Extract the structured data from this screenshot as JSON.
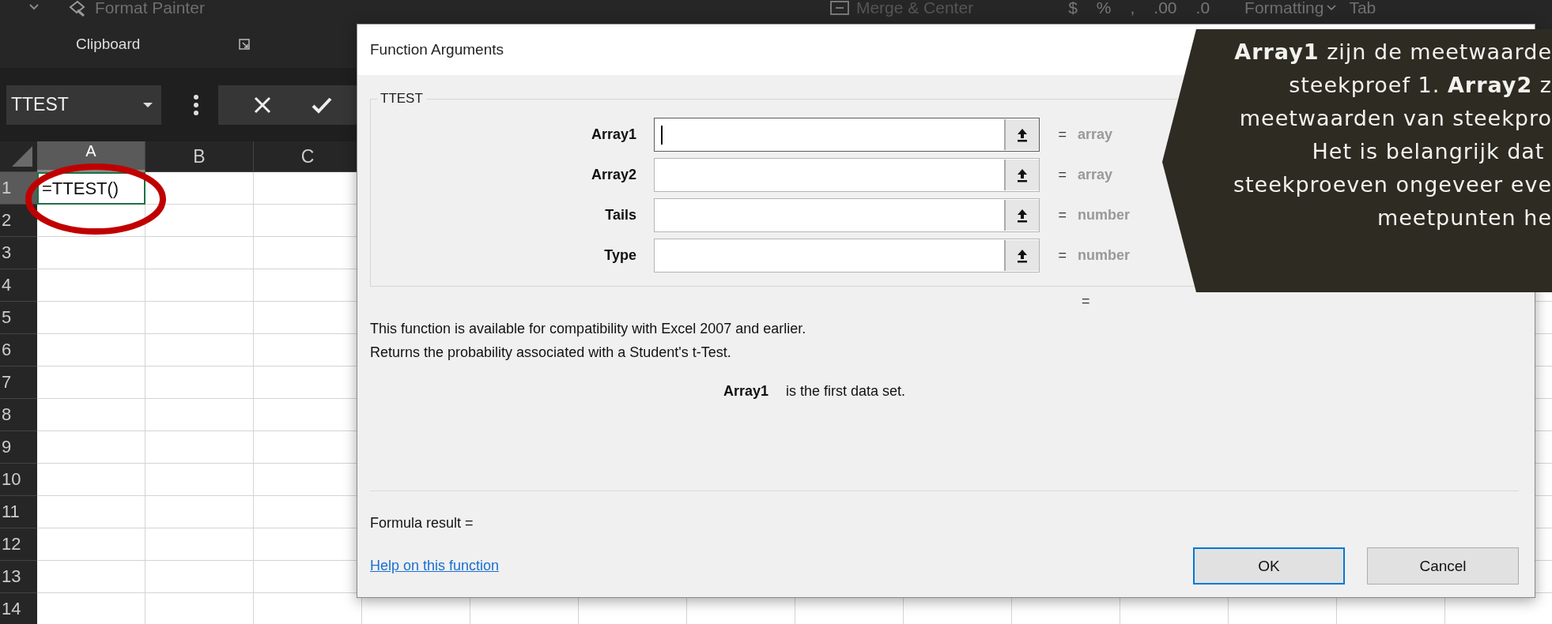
{
  "ribbon": {
    "top_texts": [
      {
        "kind": "painter",
        "text": "Format Painter"
      },
      {
        "kind": "merge",
        "text": "Merge & Center"
      },
      {
        "kind": "glyph",
        "text": "$"
      },
      {
        "kind": "glyph",
        "text": "%"
      },
      {
        "kind": "glyph",
        "text": ","
      },
      {
        "kind": "glyph",
        "text": ".00"
      },
      {
        "kind": "glyph",
        "text": ".0"
      },
      {
        "kind": "dropdown",
        "text": "Formatting"
      },
      {
        "kind": "plain",
        "text": "Tab"
      }
    ],
    "group_label": "Clipboard"
  },
  "formula_bar": {
    "name_box": "TTEST"
  },
  "sheet": {
    "columns": [
      {
        "label": "A",
        "selected": true
      },
      {
        "label": "B",
        "selected": false
      },
      {
        "label": "C",
        "selected": false
      }
    ],
    "rows": [
      {
        "label": "1",
        "selected": true
      },
      {
        "label": "2",
        "selected": false
      },
      {
        "label": "3",
        "selected": false
      },
      {
        "label": "4",
        "selected": false
      },
      {
        "label": "5",
        "selected": false
      },
      {
        "label": "6",
        "selected": false
      },
      {
        "label": "7",
        "selected": false
      },
      {
        "label": "8",
        "selected": false
      },
      {
        "label": "9",
        "selected": false
      },
      {
        "label": "10",
        "selected": false
      },
      {
        "label": "11",
        "selected": false
      },
      {
        "label": "12",
        "selected": false
      },
      {
        "label": "13",
        "selected": false
      },
      {
        "label": "14",
        "selected": false
      }
    ],
    "active_cell": "=TTEST()"
  },
  "dialog": {
    "title": "Function Arguments",
    "group_label": "TTEST",
    "arguments": [
      {
        "label": "Array1",
        "equals": "=",
        "hint": "array",
        "focused": true
      },
      {
        "label": "Array2",
        "equals": "=",
        "hint": "array",
        "focused": false
      },
      {
        "label": "Tails",
        "equals": "=",
        "hint": "number",
        "focused": false
      },
      {
        "label": "Type",
        "equals": "=",
        "hint": "number",
        "focused": false
      }
    ],
    "result_equals": "=",
    "description": [
      "This function is available for compatibility with Excel 2007 and earlier.",
      "Returns the probability associated with a Student's t-Test."
    ],
    "argument_help": {
      "name": "Array1",
      "text": "is the first data set."
    },
    "formula_result": "Formula result =",
    "help_link": "Help on this function",
    "buttons": [
      {
        "label": "OK",
        "default": true
      },
      {
        "label": "Cancel",
        "default": false
      }
    ]
  },
  "callout": {
    "lines": [
      "**Array1** zijn de meetwaarde",
      "steekproef 1. **Array2** z",
      "meetwaarden van steekpro",
      "Het is belangrijk dat ",
      "steekproeven ongeveer eve",
      "meetpunten he"
    ]
  }
}
